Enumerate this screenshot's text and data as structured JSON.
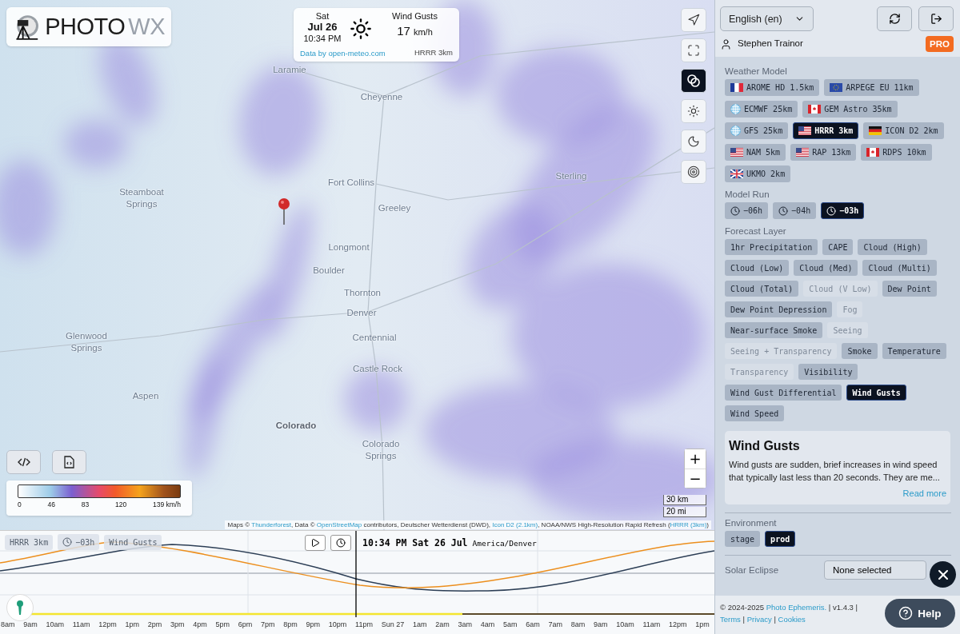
{
  "logo": {
    "primary": "PHOTO",
    "secondary": "WX"
  },
  "forecast_card": {
    "day": "Sat",
    "date": "Jul 26",
    "time": "10:34 PM",
    "layer": "Wind Gusts",
    "value": "17",
    "unit": "km/h",
    "credit": "Data by open-meteo.com",
    "model": "HRRR 3km"
  },
  "map_tools": [
    {
      "kind": "locate",
      "selected": false
    },
    {
      "kind": "fullscreen",
      "selected": false
    },
    {
      "kind": "overlay",
      "selected": true
    },
    {
      "kind": "sun",
      "selected": false
    },
    {
      "kind": "moon",
      "selected": false
    },
    {
      "kind": "target",
      "selected": false
    }
  ],
  "places": [
    {
      "name": "Laramie",
      "kind": "city"
    },
    {
      "name": "Cheyenne",
      "kind": "city"
    },
    {
      "name": "Fort Collins",
      "kind": "city"
    },
    {
      "name": "Greeley",
      "kind": "city"
    },
    {
      "name": "Sterling",
      "kind": "city"
    },
    {
      "name": "Steamboat Springs",
      "kind": "city"
    },
    {
      "name": "Longmont",
      "kind": "city"
    },
    {
      "name": "Boulder",
      "kind": "city"
    },
    {
      "name": "Thornton",
      "kind": "city"
    },
    {
      "name": "Denver",
      "kind": "city"
    },
    {
      "name": "Centennial",
      "kind": "city"
    },
    {
      "name": "Glenwood Springs",
      "kind": "city"
    },
    {
      "name": "Castle Rock",
      "kind": "city"
    },
    {
      "name": "Aspen",
      "kind": "city"
    },
    {
      "name": "Colorado",
      "kind": "state"
    },
    {
      "name": "Colorado Springs",
      "kind": "city"
    }
  ],
  "legend": {
    "ticks": [
      "0",
      "46",
      "83",
      "120",
      "139 km/h"
    ]
  },
  "zoom": [
    "+",
    "−"
  ],
  "scale": [
    "30 km",
    "20 mi"
  ],
  "attribution": [
    {
      "text": "Maps © ",
      "link": false
    },
    {
      "text": "Thunderforest",
      "link": true
    },
    {
      "text": ", Data © ",
      "link": false
    },
    {
      "text": "OpenStreetMap",
      "link": true
    },
    {
      "text": " contributors, Deutscher Wetterdienst (DWD), ",
      "link": false
    },
    {
      "text": "Icon D2 (2.1km)",
      "link": true
    },
    {
      "text": ", NOAA/NWS High-Resolution Rapid Refresh (",
      "link": false
    },
    {
      "text": "HRRR (3km)",
      "link": true
    },
    {
      "text": ")",
      "link": false
    }
  ],
  "timeline": {
    "model": "HRRR 3km",
    "run": "−03h",
    "layer": "Wind Gusts",
    "datetime": "10:34 PM Sat 26 Jul",
    "timezone": "America/Denver",
    "hours": [
      "8am",
      "9am",
      "10am",
      "11am",
      "12pm",
      "1pm",
      "2pm",
      "3pm",
      "4pm",
      "5pm",
      "6pm",
      "7pm",
      "8pm",
      "9pm",
      "10pm",
      "11pm",
      "Sun 27",
      "1am",
      "2am",
      "3am",
      "4am",
      "5am",
      "6am",
      "7am",
      "8am",
      "9am",
      "10am",
      "11am",
      "12pm",
      "1pm"
    ]
  },
  "sidebar": {
    "language": "English (en)",
    "user": "Stephen Trainor",
    "badge": "PRO",
    "weather_model": {
      "title": "Weather Model",
      "items": [
        {
          "label": "AROME HD 1.5km",
          "selected": false
        },
        {
          "label": "ARPEGE EU 11km",
          "selected": false
        },
        {
          "label": "ECMWF 25km",
          "selected": false
        },
        {
          "label": "GEM Astro 35km",
          "selected": false
        },
        {
          "label": "GFS 25km",
          "selected": false
        },
        {
          "label": "HRRR 3km",
          "selected": true
        },
        {
          "label": "ICON D2 2km",
          "selected": false
        },
        {
          "label": "NAM 5km",
          "selected": false
        },
        {
          "label": "RAP 13km",
          "selected": false
        },
        {
          "label": "RDPS 10km",
          "selected": false
        },
        {
          "label": "UKMO 2km",
          "selected": false
        }
      ]
    },
    "model_run": {
      "title": "Model Run",
      "items": [
        {
          "label": "−06h",
          "selected": false
        },
        {
          "label": "−04h",
          "selected": false
        },
        {
          "label": "−03h",
          "selected": true
        }
      ]
    },
    "forecast_layer": {
      "title": "Forecast Layer",
      "items": [
        {
          "label": "1hr Precipitation",
          "selected": false,
          "disabled": false
        },
        {
          "label": "CAPE",
          "selected": false,
          "disabled": false
        },
        {
          "label": "Cloud (High)",
          "selected": false,
          "disabled": false
        },
        {
          "label": "Cloud (Low)",
          "selected": false,
          "disabled": false
        },
        {
          "label": "Cloud (Med)",
          "selected": false,
          "disabled": false
        },
        {
          "label": "Cloud (Multi)",
          "selected": false,
          "disabled": false
        },
        {
          "label": "Cloud (Total)",
          "selected": false,
          "disabled": false
        },
        {
          "label": "Cloud (V Low)",
          "selected": false,
          "disabled": true
        },
        {
          "label": "Dew Point",
          "selected": false,
          "disabled": false
        },
        {
          "label": "Dew Point Depression",
          "selected": false,
          "disabled": false
        },
        {
          "label": "Fog",
          "selected": false,
          "disabled": true
        },
        {
          "label": "Near-surface Smoke",
          "selected": false,
          "disabled": false
        },
        {
          "label": "Seeing",
          "selected": false,
          "disabled": true
        },
        {
          "label": "Seeing + Transparency",
          "selected": false,
          "disabled": true
        },
        {
          "label": "Smoke",
          "selected": false,
          "disabled": false
        },
        {
          "label": "Temperature",
          "selected": false,
          "disabled": false
        },
        {
          "label": "Transparency",
          "selected": false,
          "disabled": true
        },
        {
          "label": "Visibility",
          "selected": false,
          "disabled": false
        },
        {
          "label": "Wind Gust Differential",
          "selected": false,
          "disabled": false
        },
        {
          "label": "Wind Gusts",
          "selected": true,
          "disabled": false
        },
        {
          "label": "Wind Speed",
          "selected": false,
          "disabled": false
        }
      ]
    },
    "info": {
      "title": "Wind Gusts",
      "text": "Wind gusts are sudden, brief increases in wind speed that typically last less than 20 seconds. They are me...",
      "link": "Read more"
    },
    "environment": {
      "title": "Environment",
      "items": [
        {
          "label": "stage",
          "selected": false
        },
        {
          "label": "prod",
          "selected": true
        }
      ]
    },
    "solar_eclipse": {
      "title": "Solar Eclipse",
      "value": "None selected"
    },
    "footer": [
      {
        "text": "© 2024-2025 ",
        "link": false
      },
      {
        "text": "Photo Ephemeris.",
        "link": true
      },
      {
        "text": " | v1.4.3 | ",
        "link": false
      },
      {
        "text": "Terms",
        "link": true
      },
      {
        "text": " | ",
        "link": false
      },
      {
        "text": "Privacy",
        "link": true
      },
      {
        "text": " | ",
        "link": false
      },
      {
        "text": "Cookies",
        "link": true
      }
    ],
    "help": "Help"
  }
}
